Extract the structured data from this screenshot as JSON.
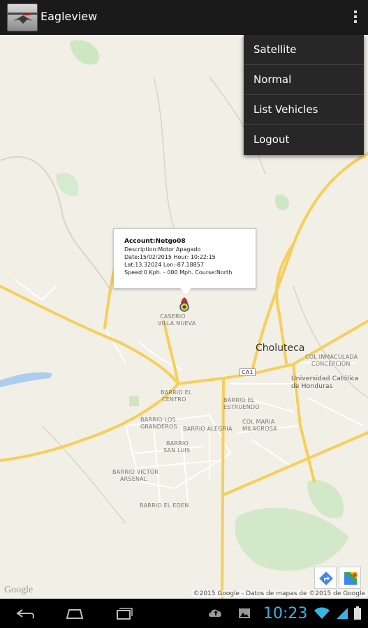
{
  "app": {
    "title": "Eagleview",
    "logo_icon": "eagleview-logo-icon"
  },
  "menu": {
    "items": [
      {
        "label": "Satellite"
      },
      {
        "label": "Normal"
      },
      {
        "label": "List Vehicles"
      },
      {
        "label": "Logout"
      }
    ]
  },
  "info_window": {
    "account": "Account:Netgo08",
    "description": "Description:Motor Apagado",
    "date_time": "Date:15/02/2015  Hour:   10:22:15",
    "lat_lon": "Lat:13.32024 Lon:-87.18857",
    "speed_course": "Speed:0 Kph.  -  000 Mph. Course:North"
  },
  "map": {
    "city": "Choluteca",
    "labels": {
      "casorio": "CASERIO",
      "villa_nueva": "VILLA NUEVA",
      "col_inmaculada": "COL INMACULADA",
      "concepcion": "CONCEPCION",
      "universidad1": "Universidad Católica",
      "universidad2": "de Honduras",
      "barrio_centro1": "BARRIO EL",
      "barrio_centro2": "CENTRO",
      "barrio_estruendo1": "BARRIO EL",
      "barrio_estruendo2": "ESTRUENDO",
      "barrio_los1": "BARRIO LOS",
      "barrio_los2": "GRANDEROS",
      "barrio_alegria": "BARRIO ALEGRIA",
      "col_maria1": "COL MARIA",
      "col_maria2": "MILAGROSA",
      "barrio_san1": "BARRIO",
      "barrio_san2": "SAN LUIS",
      "barrio_victor1": "BARRIO VICTOR",
      "barrio_victor2": "ARSENAL",
      "barrio_eden": "BARRIO EL EDEN",
      "route_ca1": "CA1"
    },
    "copyright": "©2015 Google - Datos de mapas de ©2015 de Google",
    "google_logo": "Google"
  },
  "status": {
    "time": "10:23"
  },
  "colors": {
    "road": "#f6cf5a",
    "map_bg": "#f2efe7",
    "water": "#abcdef",
    "clock": "#33b5e5"
  }
}
